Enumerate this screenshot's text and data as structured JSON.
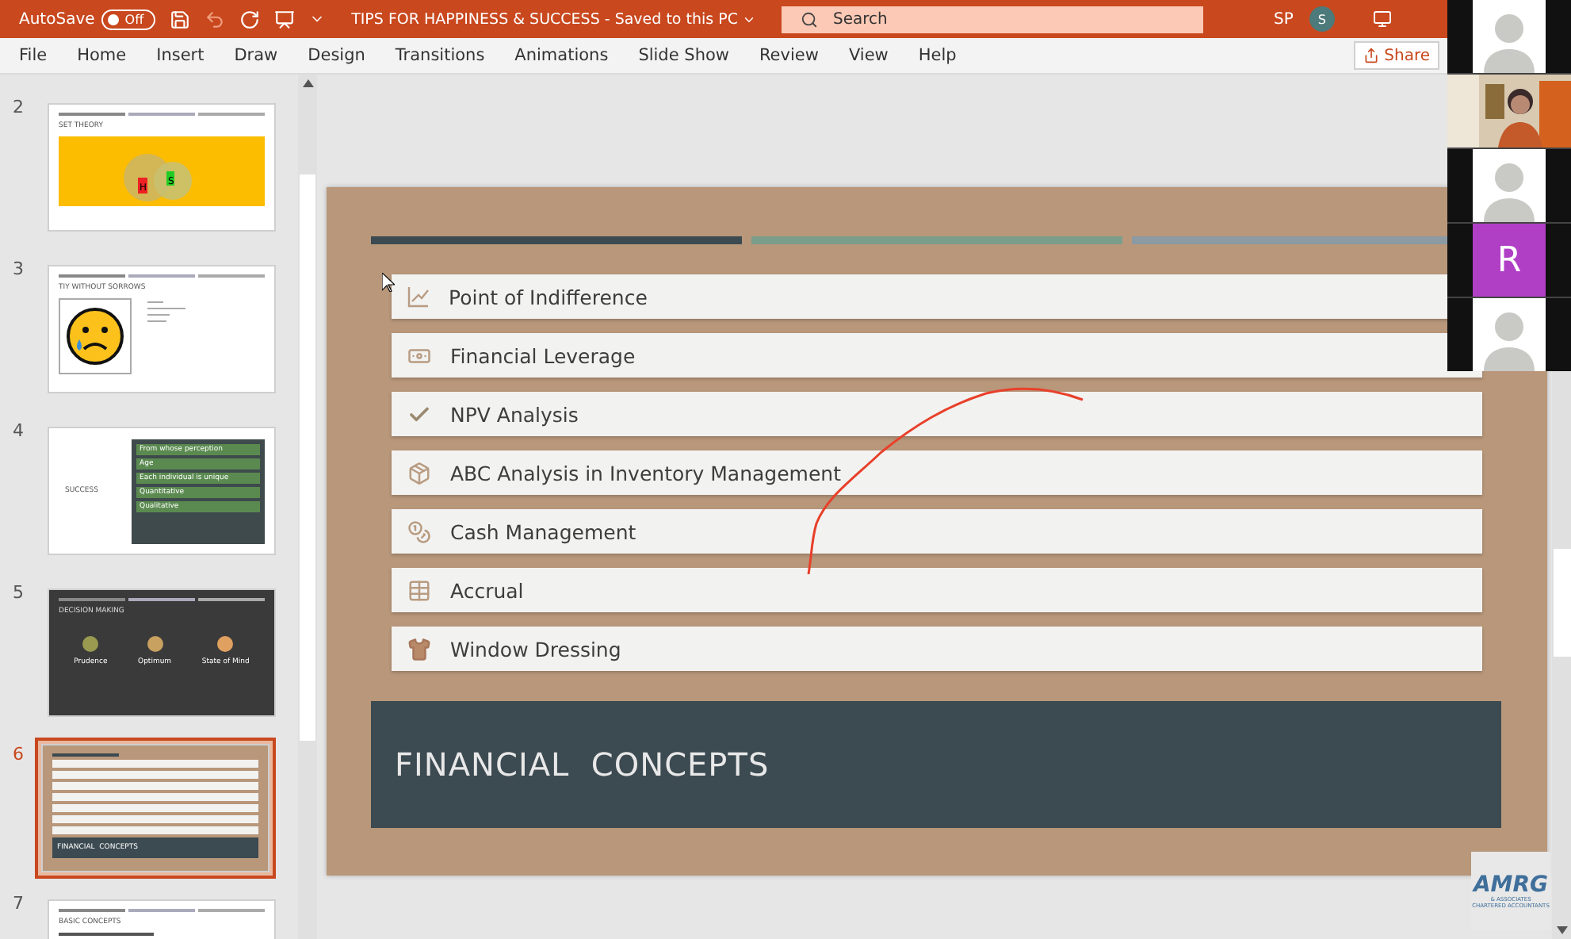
{
  "title_bar": {
    "autosave_label": "AutoSave",
    "autosave": {
      "on": false,
      "label": "Off"
    },
    "document_title": "TIPS FOR HAPPINESS & SUCCESS  -  Saved to this PC",
    "search": {
      "placeholder": "Search"
    },
    "user_initials": "SP",
    "avatar_initial": "S"
  },
  "menu": [
    "File",
    "Home",
    "Insert",
    "Draw",
    "Design",
    "Transitions",
    "Animations",
    "Slide Show",
    "Review",
    "View",
    "Help"
  ],
  "share_button": "Share",
  "thumbnails": [
    {
      "number": "2",
      "kind": "venn",
      "selected": false,
      "title": "SET THEORY",
      "labels": [
        "H",
        "S"
      ]
    },
    {
      "number": "3",
      "kind": "emoji",
      "selected": false,
      "title": "TIY WITHOUT SORROWS"
    },
    {
      "number": "4",
      "kind": "list",
      "selected": false,
      "title": "SUCCESS",
      "items": [
        "From whose perception",
        "Age",
        "Each individual is unique",
        "Quantitative",
        "Qualitative"
      ]
    },
    {
      "number": "5",
      "kind": "dark",
      "selected": false,
      "title": "DECISION MAKING",
      "items": [
        "Prudence",
        "Optimum",
        "State of Mind"
      ]
    },
    {
      "number": "6",
      "kind": "concepts",
      "selected": true,
      "title": "FINANCIAL  CONCEPTS"
    },
    {
      "number": "7",
      "kind": "text",
      "selected": false,
      "title": "BASIC CONCEPTS"
    }
  ],
  "slide": {
    "items": [
      "Point of Indifference",
      "Financial Leverage",
      "NPV Analysis",
      "ABC Analysis in Inventory Management",
      "Cash Management",
      "Accrual",
      "Window Dressing"
    ],
    "banner": "FINANCIAL  CONCEPTS"
  },
  "video_tiles": [
    {
      "kind": "avatar"
    },
    {
      "kind": "picture"
    },
    {
      "kind": "avatar"
    },
    {
      "kind": "initial",
      "initial": "R",
      "color": "#b03fc6"
    },
    {
      "kind": "avatar"
    }
  ],
  "logo": {
    "name": "AMRG",
    "line_1": "& ASSOCIATES",
    "line_2": "CHARTERED ACCOUNTANTS"
  }
}
